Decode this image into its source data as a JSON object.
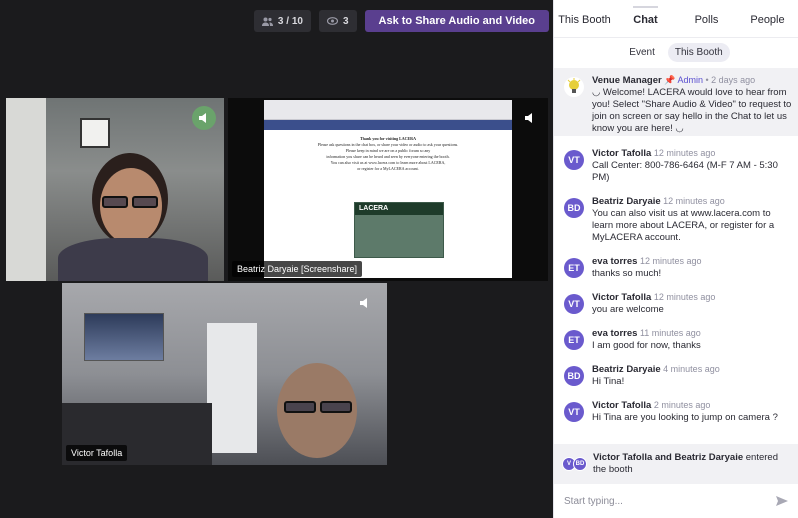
{
  "stage": {
    "attendees": "3 / 10",
    "viewers": "3",
    "ask_button": "Ask to Share Audio and Video",
    "tiles": [
      {
        "name": ""
      },
      {
        "name": "Beatriz Daryaie [Screenshare]"
      },
      {
        "name": "Victor Tafolla"
      }
    ],
    "screenshare": {
      "doc_lines": [
        "Thank you for visiting LACERA",
        "Please ask questions in the chat box, or share your video or audio to ask your questions.",
        "Please keep in mind we are on a public forum so any",
        "information you share can be heard and seen by everyone entering the booth.",
        "You can also visit us at www.lacera.com to learn more about LACERA,",
        "or register for a MyLACERA account."
      ],
      "logo": "LACERA"
    }
  },
  "sidebar": {
    "tabs": [
      "This Booth",
      "Chat",
      "Polls",
      "People"
    ],
    "active_tab": "Chat",
    "subtabs": [
      "Event",
      "This Booth"
    ],
    "active_subtab": "This Booth",
    "pinned": {
      "name": "Venue Manager",
      "role": "Admin",
      "time": "• 2 days ago",
      "text": "◡ Welcome! LACERA would love to hear from you! Select \"Share Audio & Video\" to request to join on screen or say hello in the Chat to let us know you are here! ◡"
    },
    "messages": [
      {
        "initials": "VT",
        "name": "Victor Tafolla",
        "time": "12 minutes ago",
        "text": "Call Center: 800-786-6464 (M-F 7 AM - 5:30 PM)"
      },
      {
        "initials": "BD",
        "name": "Beatriz Daryaie",
        "time": "12 minutes ago",
        "text": "You can also visit us at www.lacera.com to learn more about LACERA, or register for a MyLACERA account."
      },
      {
        "initials": "ET",
        "name": "eva torres",
        "time": "12 minutes ago",
        "text": "thanks so much!"
      },
      {
        "initials": "VT",
        "name": "Victor Tafolla",
        "time": "12 minutes ago",
        "text": "you are welcome"
      },
      {
        "initials": "ET",
        "name": "eva torres",
        "time": "11 minutes ago",
        "text": "I am good for now, thanks"
      },
      {
        "initials": "BD",
        "name": "Beatriz Daryaie",
        "time": "4 minutes ago",
        "text": "Hi Tina!"
      },
      {
        "initials": "VT",
        "name": "Victor Tafolla",
        "time": "2 minutes ago",
        "text": "Hi Tina are you looking to jump on camera ?"
      }
    ],
    "joined": {
      "avatars": [
        "V",
        "BD"
      ],
      "names": "Victor Tafolla and Beatriz Daryaie",
      "suffix": " entered the booth"
    },
    "composer_placeholder": "Start typing..."
  },
  "colors": {
    "accent": "#5a3f8f",
    "avatar": "#6a5acd",
    "stage_bg": "#1b1b1d"
  },
  "icons": {
    "attendees": "people-icon",
    "viewers": "eye-icon",
    "audio": "speaker-icon",
    "pin": "pin-icon",
    "send": "send-icon"
  }
}
